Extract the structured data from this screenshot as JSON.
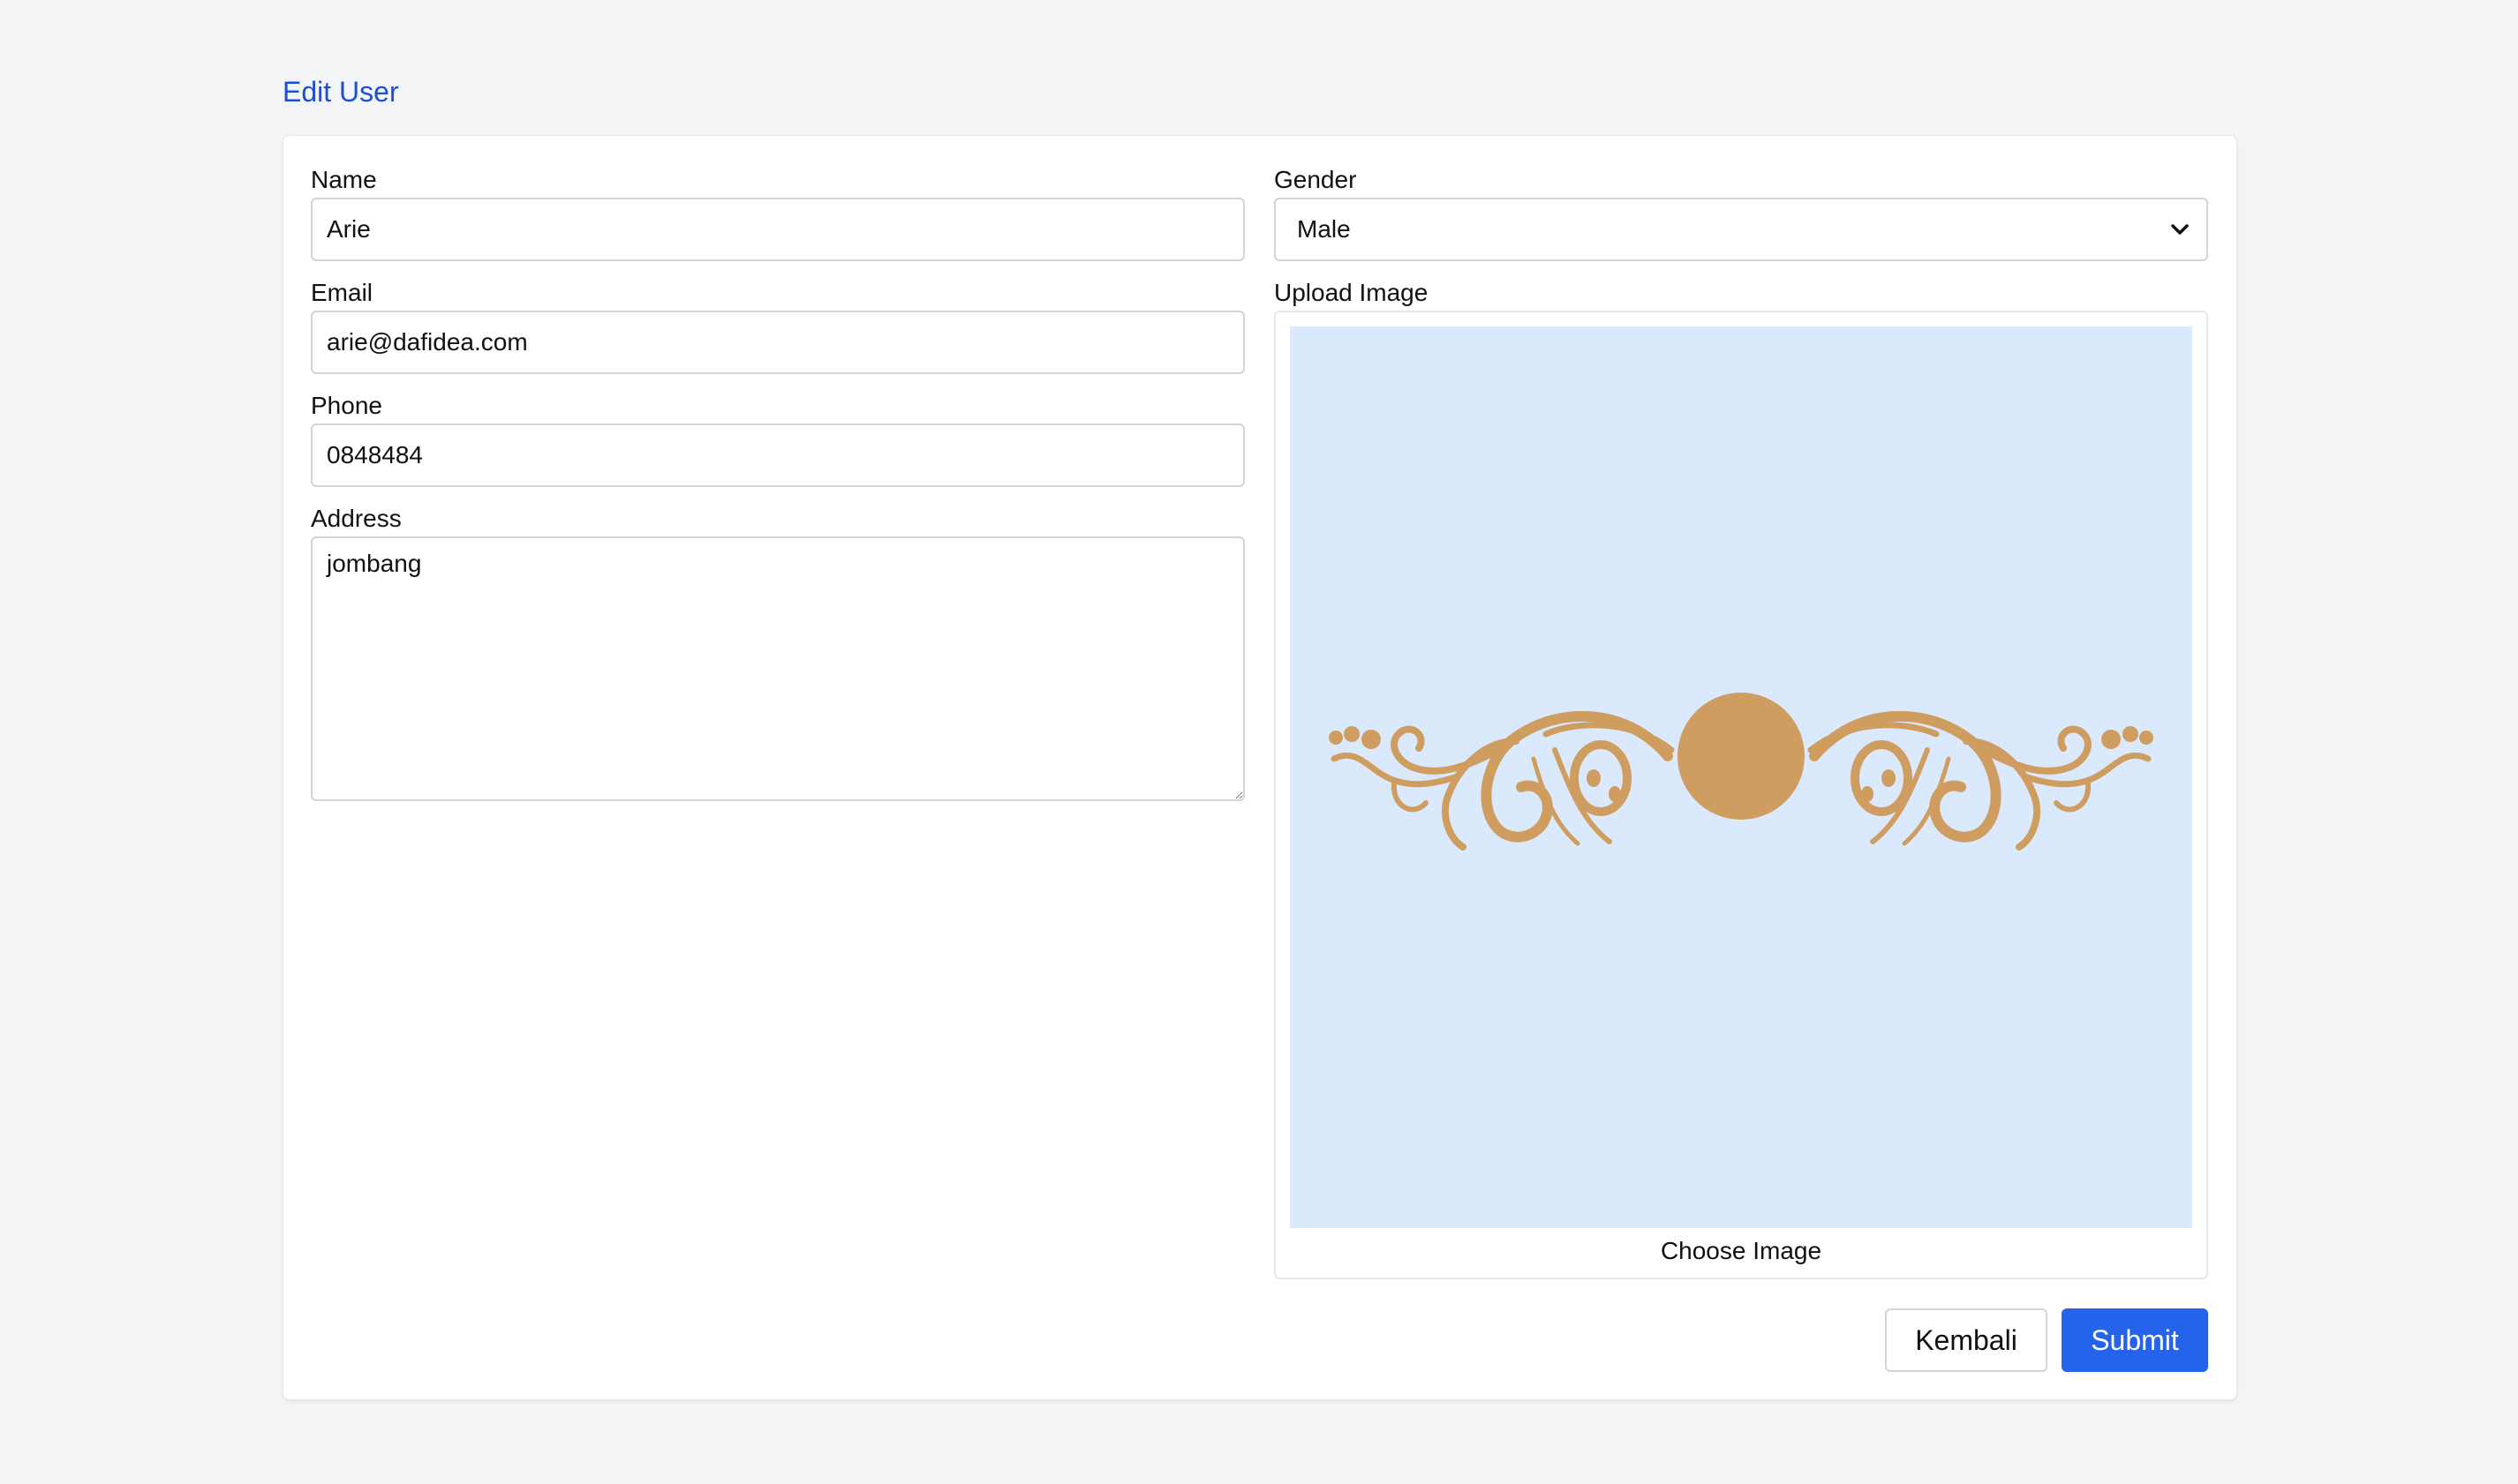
{
  "page": {
    "title": "Edit User"
  },
  "form": {
    "name": {
      "label": "Name",
      "value": "Arie"
    },
    "email": {
      "label": "Email",
      "value": "arie@dafidea.com"
    },
    "phone": {
      "label": "Phone",
      "value": "0848484"
    },
    "address": {
      "label": "Address",
      "value": "jombang"
    },
    "gender": {
      "label": "Gender",
      "value": "Male",
      "icon": "chevron-down-icon"
    },
    "upload": {
      "label": "Upload Image",
      "choose_label": "Choose Image",
      "preview_icon": "ornament-image"
    }
  },
  "actions": {
    "back_label": "Kembali",
    "submit_label": "Submit"
  },
  "colors": {
    "accent": "#2563eb",
    "title": "#1d4ed8",
    "preview_bg": "#dbe9fd",
    "ornament": "#cf9d5f",
    "page_bg": "#f3f4f6"
  }
}
